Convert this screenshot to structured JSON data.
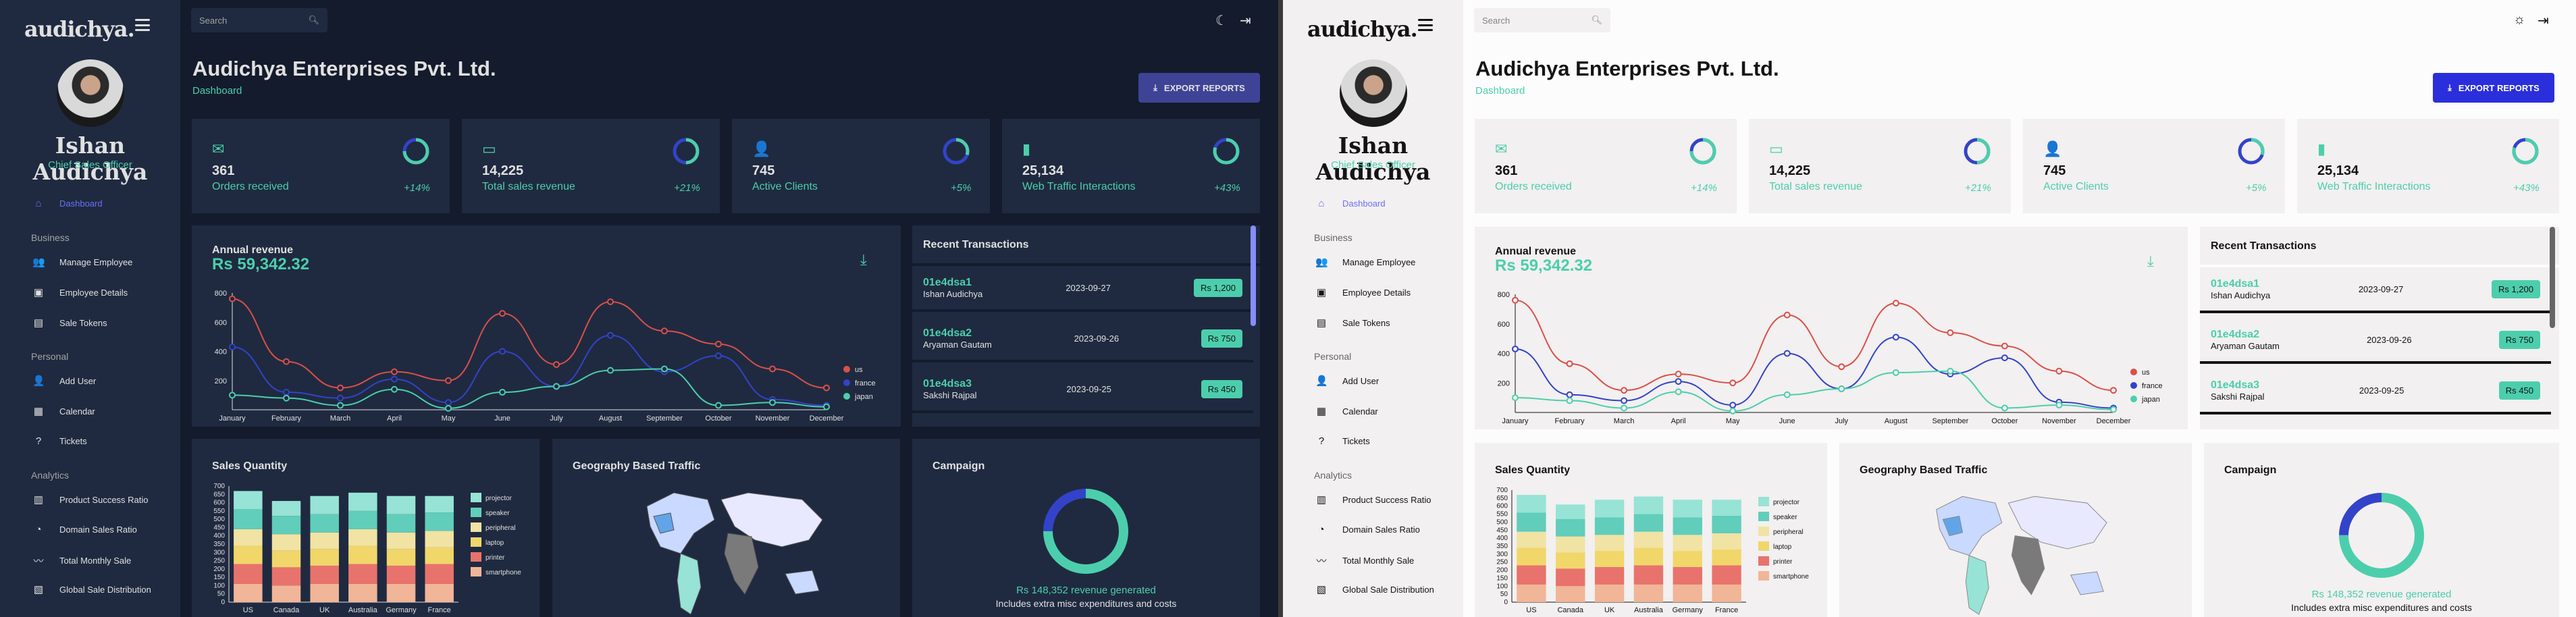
{
  "brand": {
    "logo": "audichya."
  },
  "user": {
    "name": "Ishan Audichya",
    "role": "Chief Sales Officer"
  },
  "nav": {
    "dashboard": "Dashboard",
    "sections": {
      "business": "Business",
      "personal": "Personal",
      "analytics": "Analytics"
    },
    "business": [
      "Manage Employee",
      "Employee Details",
      "Sale Tokens"
    ],
    "personal": [
      "Add User",
      "Calendar",
      "Tickets"
    ],
    "analytics": [
      "Product Success Ratio",
      "Domain Sales Ratio",
      "Total Monthly Sale",
      "Global Sale Distribution"
    ]
  },
  "search": {
    "placeholder": "Search"
  },
  "page": {
    "title": "Audichya Enterprises Pvt. Ltd.",
    "breadcrumb": "Dashboard",
    "export_label": "EXPORT REPORTS"
  },
  "stats": [
    {
      "value": "361",
      "label": "Orders received",
      "pct": "+14%",
      "progress": 0.75
    },
    {
      "value": "14,225",
      "label": "Total sales revenue",
      "pct": "+21%",
      "progress": 0.5
    },
    {
      "value": "745",
      "label": "Active Clients",
      "pct": "+5%",
      "progress": 0.3
    },
    {
      "value": "25,134",
      "label": "Web Traffic Interactions",
      "pct": "+43%",
      "progress": 0.8
    }
  ],
  "revenue": {
    "title": "Annual revenue",
    "value": "Rs 59,342.32"
  },
  "transactions": {
    "title": "Recent Transactions",
    "rows": [
      {
        "id": "01e4dsa1",
        "user": "Ishan Audichya",
        "date": "2023-09-27",
        "amount": "Rs 1,200"
      },
      {
        "id": "01e4dsa2",
        "user": "Aryaman Gautam",
        "date": "2023-09-26",
        "amount": "Rs 750"
      },
      {
        "id": "01e4dsa3",
        "user": "Sakshi Rajpal",
        "date": "2023-09-25",
        "amount": "Rs 450"
      }
    ]
  },
  "sales_quantity": {
    "title": "Sales Quantity"
  },
  "geography": {
    "title": "Geography Based Traffic"
  },
  "campaign": {
    "title": "Campaign",
    "line1": "Rs 148,352 revenue generated",
    "line2": "Includes extra misc expenditures and costs"
  },
  "colors": {
    "accent": "#4cceac",
    "blue": "#6870fa",
    "dark_bg": "#141b2d",
    "dark_card": "#1f2a40",
    "light_bg": "#fcfcfc",
    "light_card": "#f2f0f0"
  },
  "chart_data": [
    {
      "type": "line",
      "title": "Annual revenue",
      "x": [
        "January",
        "February",
        "March",
        "April",
        "May",
        "June",
        "July",
        "August",
        "September",
        "October",
        "November",
        "December"
      ],
      "ylim": [
        0,
        800
      ],
      "yticks": [
        200,
        400,
        600,
        800
      ],
      "legend": "right",
      "series": [
        {
          "name": "us",
          "color": "#db4f4a",
          "values": [
            760,
            330,
            150,
            260,
            200,
            660,
            310,
            740,
            540,
            450,
            280,
            150
          ]
        },
        {
          "name": "france",
          "color": "#3343c9",
          "values": [
            430,
            120,
            80,
            210,
            50,
            400,
            160,
            510,
            260,
            370,
            70,
            30
          ]
        },
        {
          "name": "japan",
          "color": "#4cceac",
          "values": [
            100,
            80,
            30,
            140,
            10,
            120,
            160,
            270,
            280,
            30,
            50,
            20
          ]
        }
      ]
    },
    {
      "type": "bar",
      "title": "Sales Quantity",
      "categories": [
        "US",
        "Canada",
        "UK",
        "Australia",
        "Germany",
        "France"
      ],
      "ylim": [
        0,
        700
      ],
      "yticks": [
        0,
        50,
        100,
        150,
        200,
        250,
        300,
        350,
        400,
        450,
        500,
        550,
        600,
        650,
        700
      ],
      "stacked": true,
      "legend": "right",
      "series": [
        {
          "name": "smartphone",
          "color": "#f1b598",
          "values": [
            110,
            100,
            110,
            110,
            110,
            110
          ]
        },
        {
          "name": "printer",
          "color": "#e8736c",
          "values": [
            120,
            110,
            110,
            120,
            110,
            120
          ]
        },
        {
          "name": "laptop",
          "color": "#f1d66a",
          "values": [
            110,
            100,
            100,
            110,
            100,
            100
          ]
        },
        {
          "name": "peripheral",
          "color": "#f1e3a3",
          "values": [
            100,
            100,
            100,
            100,
            100,
            100
          ]
        },
        {
          "name": "speaker",
          "color": "#61cdbb",
          "values": [
            120,
            110,
            110,
            110,
            110,
            110
          ]
        },
        {
          "name": "projector",
          "color": "#97e3d5",
          "values": [
            110,
            90,
            110,
            110,
            110,
            100
          ]
        }
      ]
    },
    {
      "type": "pie",
      "title": "Campaign",
      "values": [
        75,
        25
      ],
      "colors": [
        "#4cceac",
        "#3343c9"
      ]
    }
  ]
}
